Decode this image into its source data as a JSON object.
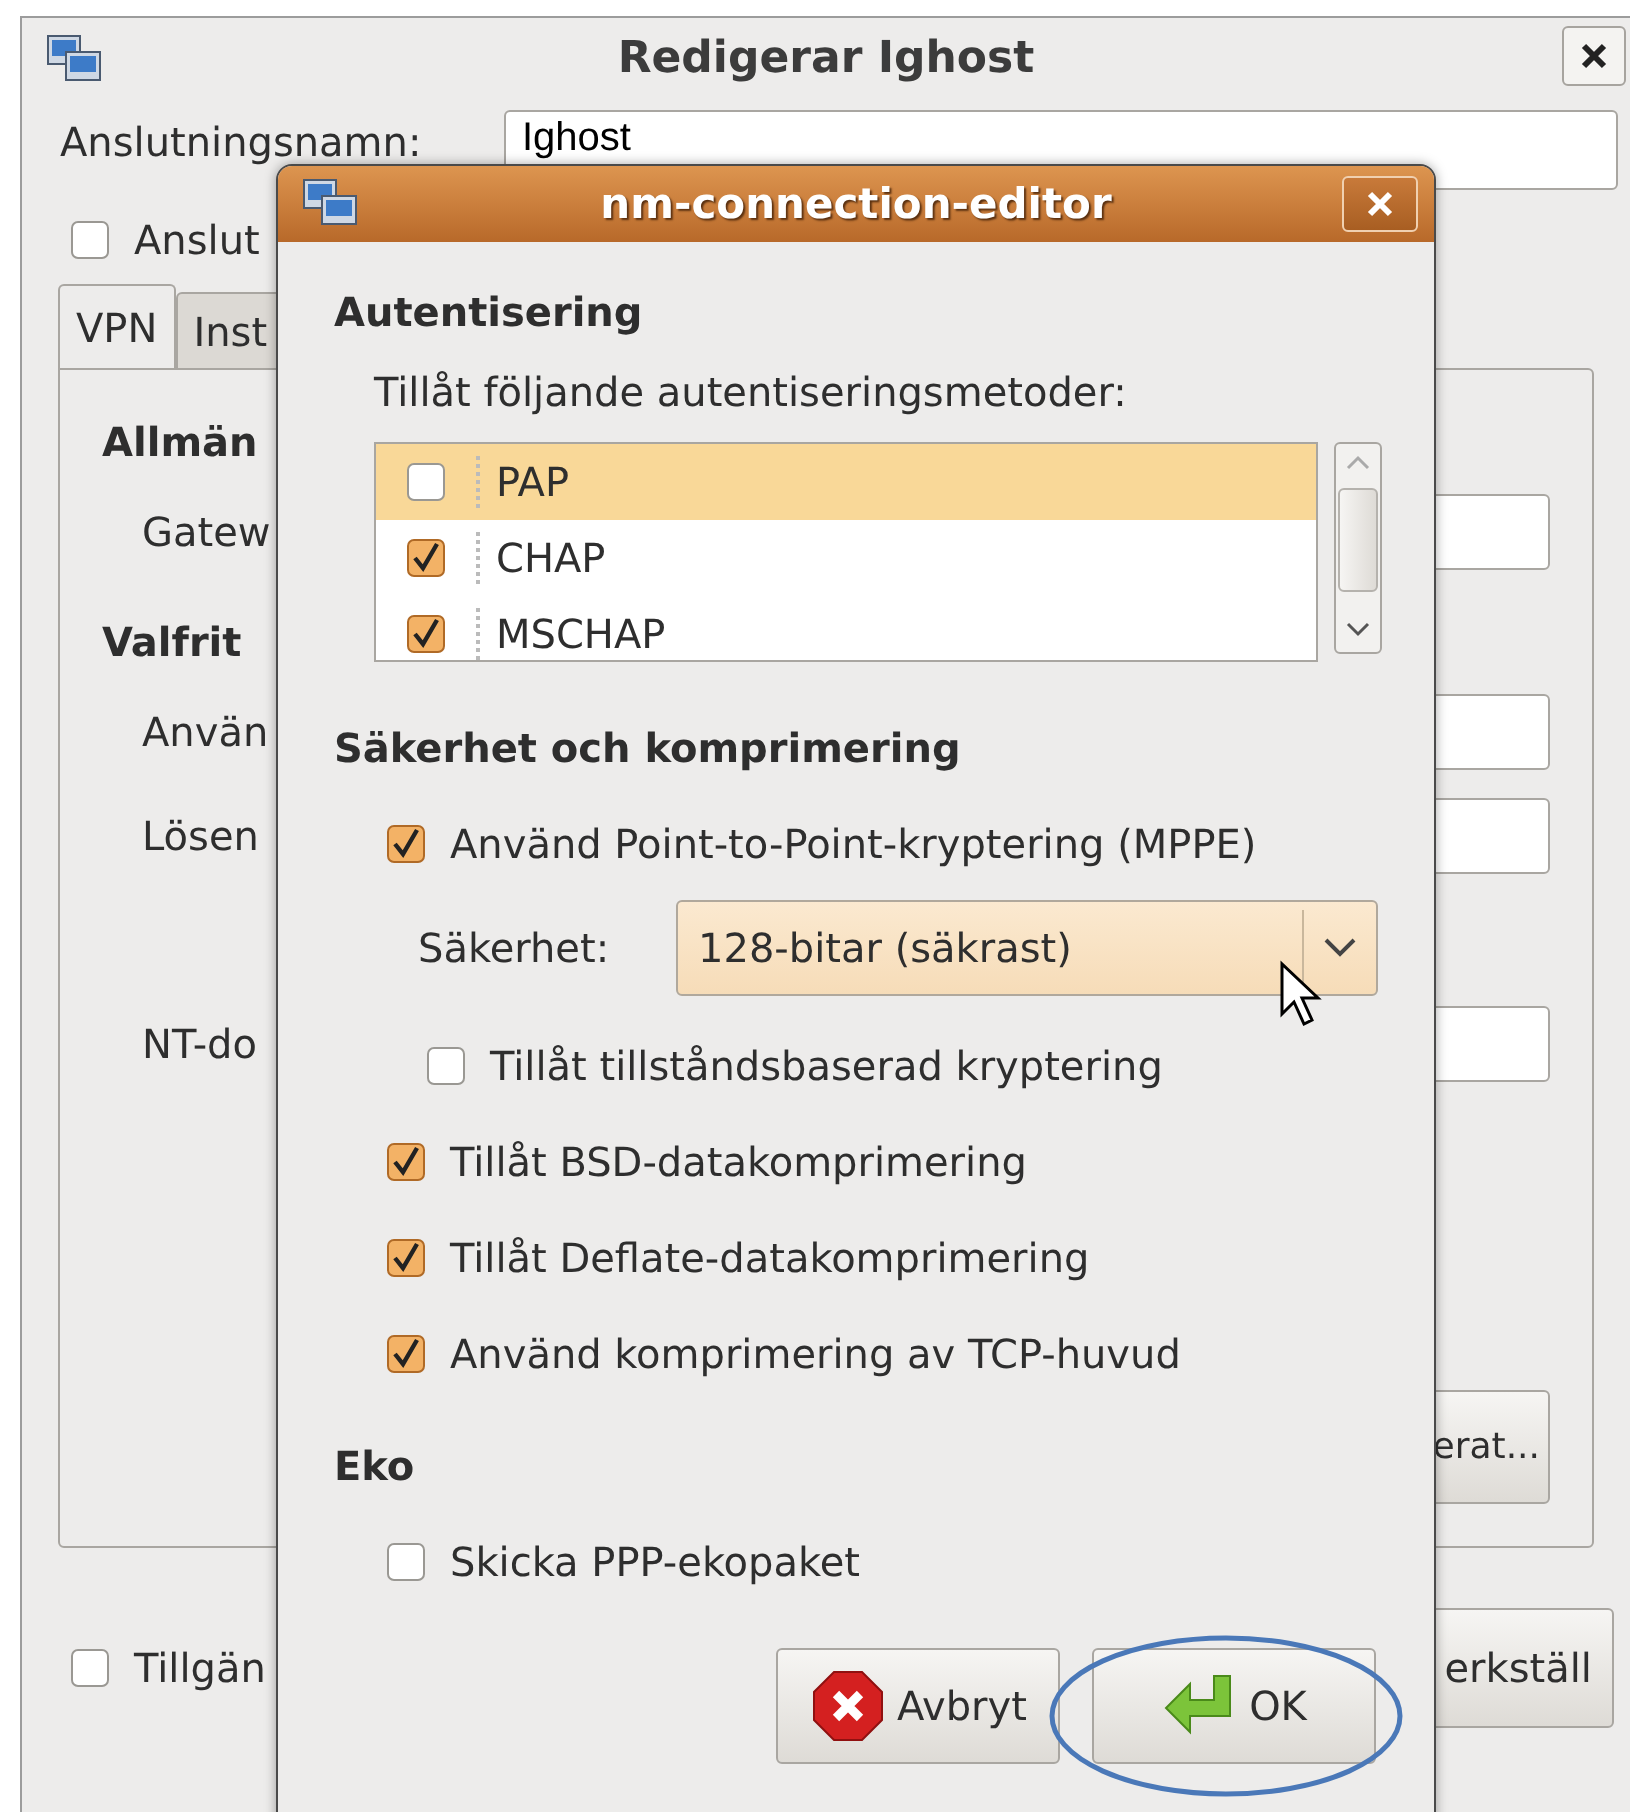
{
  "background_window": {
    "title": "Redigerar Ighost",
    "name_label": "Anslutningsnamn:",
    "name_value": "Ighost",
    "connect_checkbox": {
      "label": "Anslut",
      "checked": false
    },
    "tabs": [
      {
        "label": "VPN",
        "selected": true
      },
      {
        "label": "Inst",
        "selected": false
      }
    ],
    "sections": [
      {
        "heading": "Allmän",
        "fields": [
          {
            "label": "Gatew"
          }
        ]
      },
      {
        "heading": "Valfrit",
        "fields": [
          {
            "label": "Använ"
          },
          {
            "label": "Lösen"
          },
          {
            "label": "NT-do"
          }
        ]
      }
    ],
    "advanced_button": "erat...",
    "all_users_checkbox": {
      "label": "Tillgän",
      "checked": false
    },
    "apply_button": "erkställ"
  },
  "dialog": {
    "title": "nm-connection-editor",
    "sections": [
      {
        "heading": "Autentisering",
        "items": [
          {
            "kind": "text",
            "label": "Tillåt följande autentiseringsmetoder:"
          },
          {
            "kind": "list",
            "rows": [
              {
                "label": "PAP",
                "checked": false,
                "selected": true
              },
              {
                "label": "CHAP",
                "checked": true,
                "selected": false
              },
              {
                "label": "MSCHAP",
                "checked": true,
                "selected": false
              }
            ]
          }
        ]
      },
      {
        "heading": "Säkerhet och komprimering",
        "items": [
          {
            "kind": "check",
            "label": "Använd Point-to-Point-kryptering (MPPE)",
            "checked": true
          },
          {
            "kind": "combo",
            "label": "Säkerhet:",
            "value": "128-bitar (säkrast)"
          },
          {
            "kind": "subcheck",
            "label": "Tillåt tillståndsbaserad kryptering",
            "checked": false
          },
          {
            "kind": "check",
            "label": "Tillåt BSD-datakomprimering",
            "checked": true
          },
          {
            "kind": "check",
            "label": "Tillåt Deflate-datakomprimering",
            "checked": true
          },
          {
            "kind": "check",
            "label": "Använd komprimering av TCP-huvud",
            "checked": true
          }
        ]
      },
      {
        "heading": "Eko",
        "items": [
          {
            "kind": "check",
            "label": "Skicka PPP-ekopaket",
            "checked": false
          }
        ]
      }
    ],
    "buttons": [
      {
        "kind": "cancel",
        "label": "Avbryt"
      },
      {
        "kind": "ok",
        "label": "OK"
      }
    ]
  }
}
